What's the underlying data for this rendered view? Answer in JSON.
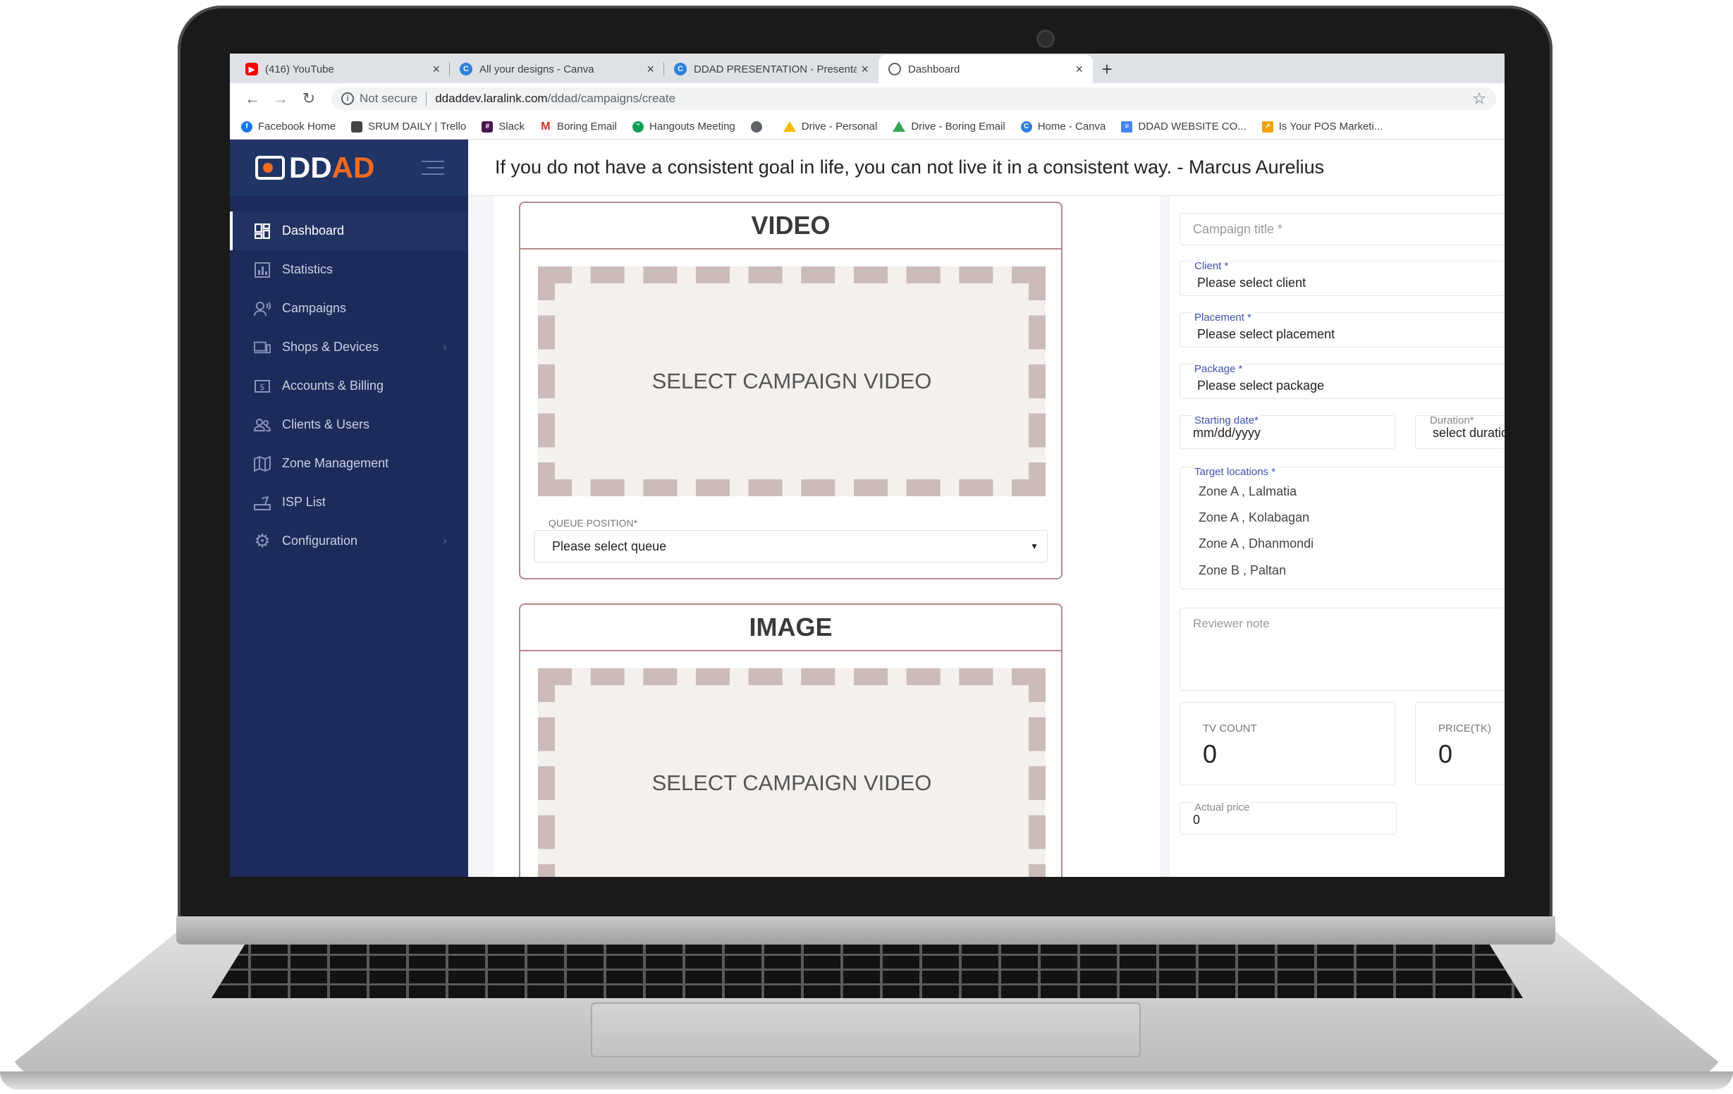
{
  "browser": {
    "tabs": [
      {
        "label": "(416) YouTube",
        "icon": "youtube-icon",
        "color": "#ff0000",
        "active": false
      },
      {
        "label": "All your designs - Canva",
        "icon": "canva-icon",
        "color": "#2f7fe0",
        "active": false
      },
      {
        "label": "DDAD PRESENTATION - Presenta",
        "icon": "canva-icon",
        "color": "#2f7fe0",
        "active": false
      },
      {
        "label": "Dashboard",
        "icon": "globe-icon",
        "color": "#5f6368",
        "active": true
      }
    ],
    "new_tab": "+",
    "close_glyph": "×",
    "nav": {
      "back": "←",
      "forward": "→",
      "reload": "↻"
    },
    "security_label": "Not secure",
    "url_host": "ddaddev.laralink.com",
    "url_path": "/ddad/campaigns/create",
    "bookmarks": [
      {
        "label": "Facebook Home",
        "icon": "facebook-icon",
        "color": "#1877f2"
      },
      {
        "label": "SRUM DAILY | Trello",
        "icon": "trello-icon",
        "color": "#444444"
      },
      {
        "label": "Slack",
        "icon": "slack-icon",
        "color": "#4a154b"
      },
      {
        "label": "Boring Email",
        "icon": "gmail-icon",
        "color": "#d93025"
      },
      {
        "label": "Hangouts Meeting",
        "icon": "hangouts-icon",
        "color": "#0f9d58"
      },
      {
        "label": "",
        "icon": "globe-icon",
        "color": "#5f6368"
      },
      {
        "label": "Drive - Personal",
        "icon": "drive-icon",
        "color": "#fbbc04"
      },
      {
        "label": "Drive - Boring Email",
        "icon": "drive-icon",
        "color": "#fbbc04"
      },
      {
        "label": "Home - Canva",
        "icon": "canva-icon",
        "color": "#2f7fe0"
      },
      {
        "label": "DDAD WEBSITE CO...",
        "icon": "docs-icon",
        "color": "#4285f4"
      },
      {
        "label": "Is Your POS Marketi...",
        "icon": "bookmark-icon",
        "color": "#f4a100"
      }
    ]
  },
  "brand": {
    "part1": "DD",
    "part2": "AD",
    "accent": "#f36b21"
  },
  "sidebar": {
    "items": [
      {
        "label": "Dashboard",
        "icon": "dashboard-icon",
        "active": true,
        "has_children": false
      },
      {
        "label": "Statistics",
        "icon": "statistics-icon",
        "active": false,
        "has_children": false
      },
      {
        "label": "Campaigns",
        "icon": "campaigns-icon",
        "active": false,
        "has_children": false
      },
      {
        "label": "Shops & Devices",
        "icon": "devices-icon",
        "active": false,
        "has_children": true
      },
      {
        "label": "Accounts & Billing",
        "icon": "billing-icon",
        "active": false,
        "has_children": false
      },
      {
        "label": "Clients & Users",
        "icon": "users-icon",
        "active": false,
        "has_children": false
      },
      {
        "label": "Zone Management",
        "icon": "map-icon",
        "active": false,
        "has_children": false
      },
      {
        "label": "ISP List",
        "icon": "isp-icon",
        "active": false,
        "has_children": false
      },
      {
        "label": "Configuration",
        "icon": "gear-icon",
        "active": false,
        "has_children": true
      }
    ]
  },
  "quote": "If you do not have a consistent goal in life, you can not live it in a consistent way. - Marcus Aurelius",
  "video_panel": {
    "title": "VIDEO",
    "dropzone": "SELECT CAMPAIGN VIDEO",
    "queue_label": "QUEUE POSITION*",
    "queue_value": "Please select queue"
  },
  "image_panel": {
    "title": "IMAGE",
    "dropzone": "SELECT CAMPAIGN VIDEO"
  },
  "form": {
    "campaign_title_placeholder": "Campaign title *",
    "client_label": "Client *",
    "client_value": "Please select client",
    "placement_label": "Placement *",
    "placement_value": "Please select placement",
    "package_label": "Package *",
    "package_value": "Please select package",
    "start_label": "Starting date*",
    "start_value": "mm/dd/yyyy",
    "duration_label": "Duration*",
    "duration_value": "select duration",
    "locations_label": "Target locations *",
    "locations": [
      "Zone A , Lalmatia",
      "Zone A , Kolabagan",
      "Zone A , Dhanmondi",
      "Zone B , Paltan"
    ],
    "reviewer_placeholder": "Reviewer note",
    "tv_count_label": "TV COUNT",
    "tv_count_value": "0",
    "price_label": "PRICE(TK)",
    "price_value": "0",
    "actual_price_label": "Actual price",
    "actual_price_value": "0"
  }
}
